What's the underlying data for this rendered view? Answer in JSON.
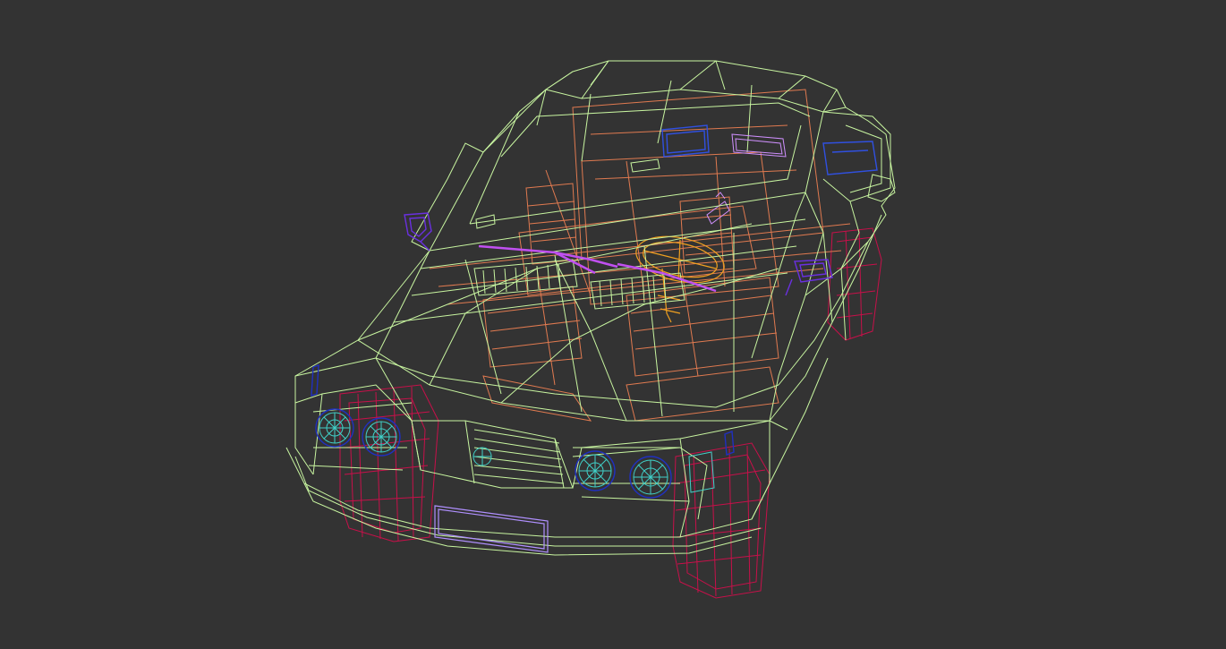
{
  "viewport": {
    "background": "#333333",
    "content": "wireframe-car-model",
    "render_mode": "wireframe"
  },
  "colors": {
    "body": "#c8f5a0",
    "interior": "#e07a50",
    "wheels": "#c8104a",
    "headlights": "#40d0c8",
    "headlight_rims": "#2030c0",
    "mirrors": "#6a30e0",
    "wipers": "#c050f0",
    "steering": "#f0a020",
    "license_plate": "#b090ff"
  }
}
